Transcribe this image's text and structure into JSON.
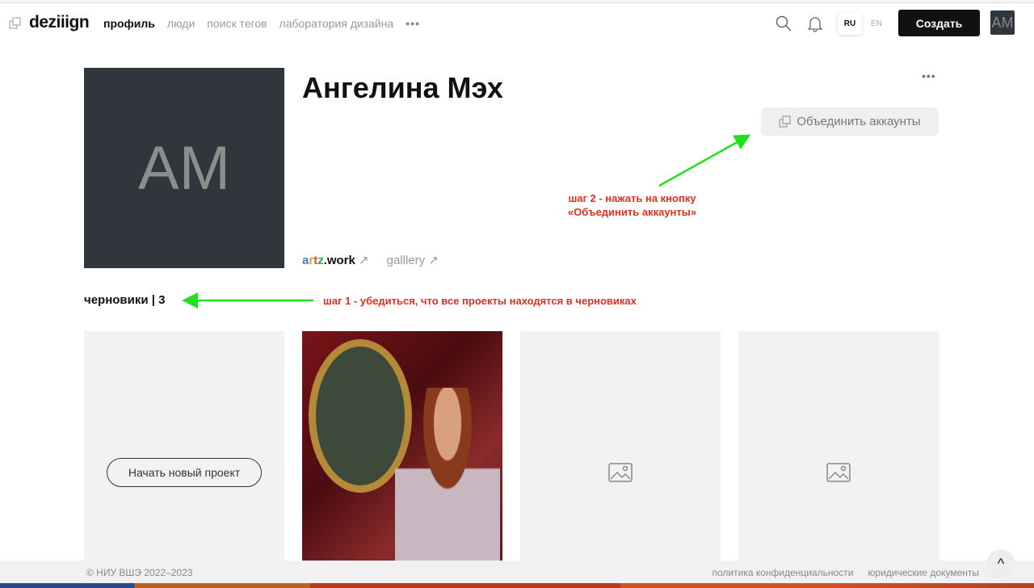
{
  "nav": {
    "logo": "deziiign",
    "links": [
      "профиль",
      "люди",
      "поиск тегов",
      "лаборатория дизайна"
    ],
    "more": "•••",
    "lang_ru": "RU",
    "lang_en": "EN",
    "create": "Создать",
    "avatar": "AM"
  },
  "profile": {
    "initials": "AM",
    "name": "Ангелина Мэх",
    "more": "•••",
    "merge_button": "Объединить аккаунты",
    "links": {
      "artz_a": "a",
      "artz_r": "r",
      "artz_t": "t",
      "artz_z": "z",
      "artz_rest": ".work",
      "gallery": "galllery",
      "arrow": "↗"
    }
  },
  "annotations": {
    "step2_line1": "шаг 2 - нажать на кнопку",
    "step2_line2": "«Объединить аккаунты»",
    "step1": "шаг 1 - убедиться, что все проекты находятся в черновиках",
    "arrow_color": "#22e11a"
  },
  "drafts": {
    "label": "черновики",
    "count": "3"
  },
  "cards": {
    "new_project": "Начать новый проект"
  },
  "footer": {
    "copyright": "© НИУ ВШЭ 2022–2023",
    "privacy": "политика конфиденциальности",
    "legal": "юридические документы",
    "up": "^"
  }
}
